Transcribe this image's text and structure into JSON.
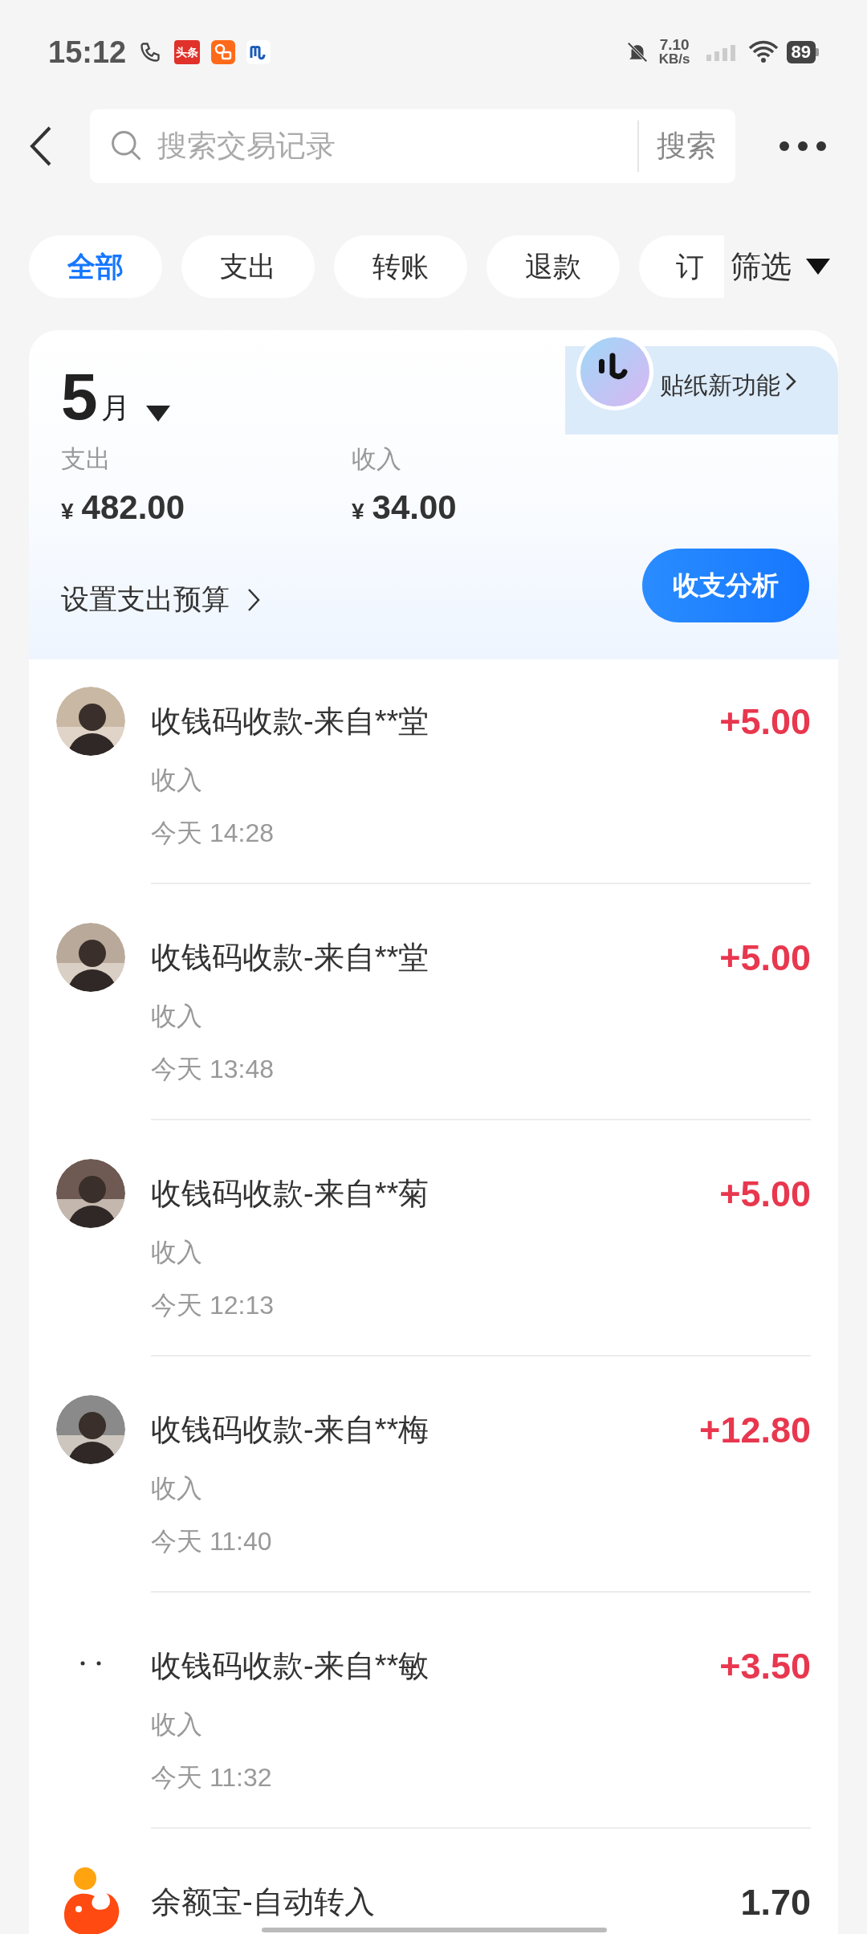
{
  "status_bar": {
    "time": "15:12",
    "app_badge": "头条",
    "network_speed": "7.10",
    "network_unit": "KB/s",
    "battery": "89"
  },
  "search": {
    "placeholder": "搜索交易记录",
    "button": "搜索"
  },
  "filters": [
    {
      "label": "全部",
      "selected": true
    },
    {
      "label": "支出",
      "selected": false
    },
    {
      "label": "转账",
      "selected": false
    },
    {
      "label": "退款",
      "selected": false
    },
    {
      "label": "订",
      "selected": false
    }
  ],
  "filter_button": "筛选",
  "sticker_banner": "贴纸新功能",
  "summary": {
    "month": "5",
    "month_unit": "月",
    "expense_label": "支出",
    "expense": "482.00",
    "income_label": "收入",
    "income": "34.00",
    "currency": "¥",
    "budget_link": "设置支出预算",
    "analysis_button": "收支分析"
  },
  "transactions": [
    {
      "title": "收钱码收款-来自**堂",
      "category": "收入",
      "time": "今天 14:28",
      "amount": "+5.00",
      "color": "#e8374e"
    },
    {
      "title": "收钱码收款-来自**堂",
      "category": "收入",
      "time": "今天 13:48",
      "amount": "+5.00",
      "color": "#e8374e"
    },
    {
      "title": "收钱码收款-来自**菊",
      "category": "收入",
      "time": "今天 12:13",
      "amount": "+5.00",
      "color": "#e8374e"
    },
    {
      "title": "收钱码收款-来自**梅",
      "category": "收入",
      "time": "今天 11:40",
      "amount": "+12.80",
      "color": "#e8374e"
    },
    {
      "kind": "dots",
      "title": "收钱码收款-来自**敏",
      "category": "收入",
      "time": "今天 11:32",
      "amount": "+3.50",
      "color": "#e8374e"
    },
    {
      "kind": "fund",
      "title": "余额宝-自动转入",
      "amount": "1.70",
      "color": "#333333"
    }
  ]
}
